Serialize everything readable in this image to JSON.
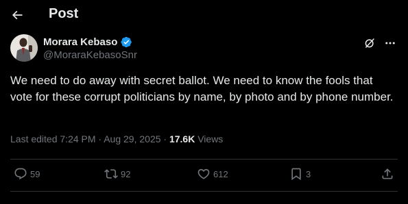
{
  "header": {
    "title": "Post"
  },
  "author": {
    "name": "Morara Kebaso",
    "handle": "@MoraraKebasoSnr"
  },
  "post": {
    "text": "We need to do away with secret ballot. We need to know the fools that vote for these corrupt politicians by name, by photo and by phone number.",
    "edited_label": "Last edited",
    "time": "7:24 PM",
    "date": "Aug 29, 2025",
    "separator": "·",
    "views_count": "17.6K",
    "views_label": "Views"
  },
  "actions": {
    "replies": "59",
    "reposts": "92",
    "likes": "612",
    "bookmarks": "3"
  },
  "colors": {
    "background": "#000000",
    "text": "#e7e9ea",
    "muted": "#71767b",
    "divider": "#2f3336",
    "verified": "#1d9bf0"
  },
  "icons": [
    "back-arrow-icon",
    "verified-badge-icon",
    "grok-icon",
    "more-icon",
    "reply-icon",
    "repost-icon",
    "like-icon",
    "bookmark-icon",
    "share-icon"
  ]
}
